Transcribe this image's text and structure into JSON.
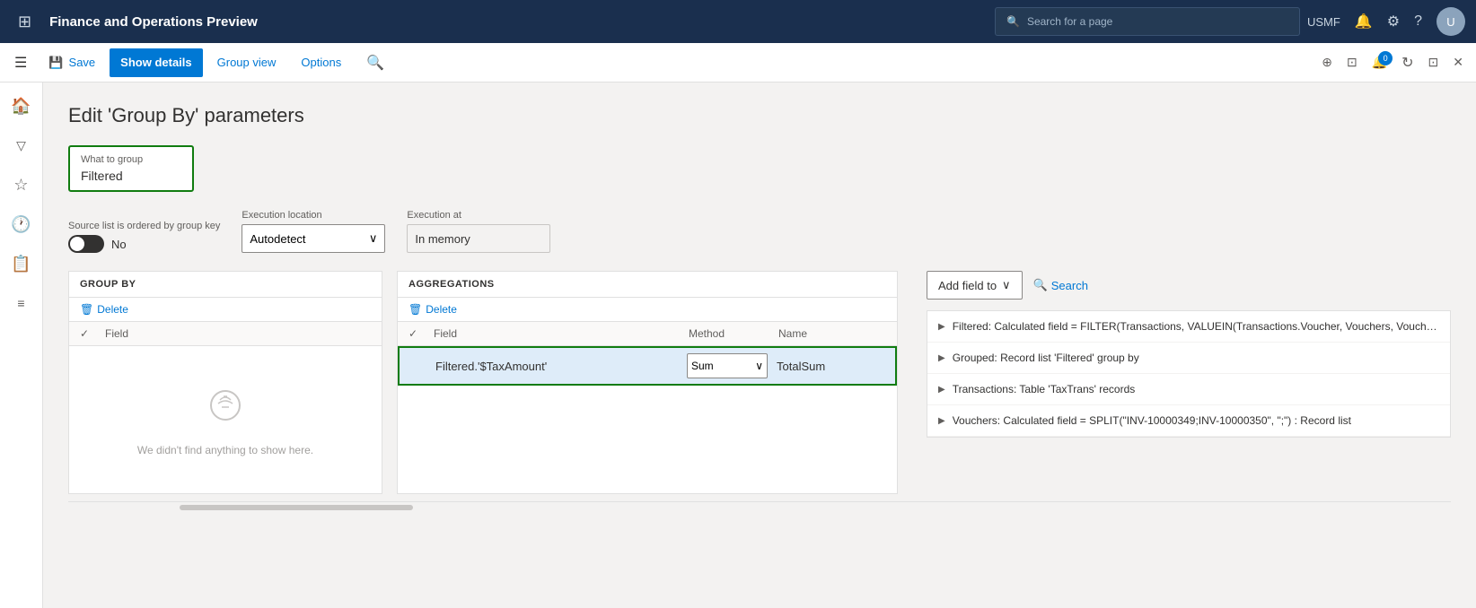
{
  "topNav": {
    "gridIcon": "⊞",
    "title": "Finance and Operations Preview",
    "search": {
      "icon": "🔍",
      "placeholder": "Search for a page"
    },
    "user": "USMF",
    "bellIcon": "🔔",
    "gearIcon": "⚙",
    "helpIcon": "?",
    "avatarLabel": "U"
  },
  "commandBar": {
    "hamburgerIcon": "☰",
    "saveBtn": {
      "icon": "💾",
      "label": "Save"
    },
    "showDetailsBtn": {
      "label": "Show details"
    },
    "groupViewBtn": {
      "label": "Group view"
    },
    "optionsBtn": {
      "label": "Options"
    },
    "searchIcon": "🔍",
    "rightIcons": {
      "pinIcon": "⊞",
      "openIcon": "⊡",
      "notificationIcon": "🔔",
      "badgeCount": "0",
      "refreshIcon": "↻",
      "expandIcon": "⊡",
      "closeIcon": "✕"
    }
  },
  "sidebar": {
    "items": [
      {
        "icon": "🏠",
        "name": "home"
      },
      {
        "icon": "☆",
        "name": "favorites"
      },
      {
        "icon": "🕐",
        "name": "recent"
      },
      {
        "icon": "📋",
        "name": "workspaces"
      },
      {
        "icon": "≡",
        "name": "modules"
      }
    ]
  },
  "page": {
    "title": "Edit 'Group By' parameters",
    "whatToGroup": {
      "label": "What to group",
      "value": "Filtered"
    },
    "sourceListLabel": "Source list is ordered by group key",
    "toggleValue": "No",
    "executionLocation": {
      "label": "Execution location",
      "value": "Autodetect"
    },
    "executionAt": {
      "label": "Execution at",
      "value": "In memory"
    },
    "groupBy": {
      "sectionLabel": "GROUP BY",
      "deleteBtn": "Delete",
      "columnCheck": "✓",
      "columnField": "Field",
      "emptyText": "We didn't find anything to show here."
    },
    "aggregations": {
      "sectionLabel": "AGGREGATIONS",
      "deleteBtn": "Delete",
      "columnCheck": "✓",
      "columnField": "Field",
      "columnMethod": "Method",
      "columnName": "Name",
      "row": {
        "field": "Filtered.'$TaxAmount'",
        "method": "Sum",
        "name": "TotalSum"
      }
    },
    "rightPanel": {
      "addFieldBtn": "Add field to",
      "addFieldChevron": "∨",
      "searchLabel": "Search",
      "searchIcon": "🔍",
      "items": [
        {
          "text": "Filtered: Calculated field = FILTER(Transactions, VALUEIN(Transactions.Voucher, Vouchers, Vouchers.Voucher))"
        },
        {
          "text": "Grouped: Record list 'Filtered' group by"
        },
        {
          "text": "Transactions: Table 'TaxTrans' records"
        },
        {
          "text": "Vouchers: Calculated field = SPLIT(\"INV-10000349;INV-10000350\", \";\") : Record list"
        }
      ]
    }
  }
}
